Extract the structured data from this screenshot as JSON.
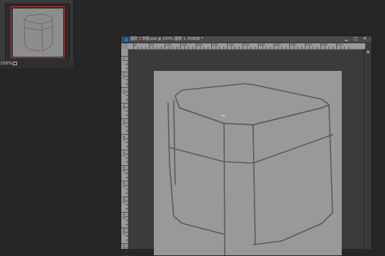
{
  "navigator": {
    "zoom": "100%",
    "zoom_button_icon": "zoom-slider-icon"
  },
  "document": {
    "title": "图层 1 草图.psb @ 100% (图层 1, RGB/8) *",
    "icon": "photoshop-doc-icon",
    "controls": {
      "minimize": "▁",
      "maximize": "□",
      "close": "✕"
    },
    "ruler_h_labels": [
      "0",
      "50",
      "100",
      "150",
      "200",
      "250",
      "300",
      "350",
      "400",
      "450",
      "500",
      "550",
      "600",
      "650"
    ],
    "ruler_v_labels": [
      "50",
      "100",
      "150",
      "200",
      "250",
      "300",
      "350",
      "400",
      "450",
      "500",
      "550",
      "600",
      "650"
    ]
  },
  "colors": {
    "background": "#262626",
    "canvas": "#999999",
    "sketch_stroke": "#5a5a5a"
  }
}
